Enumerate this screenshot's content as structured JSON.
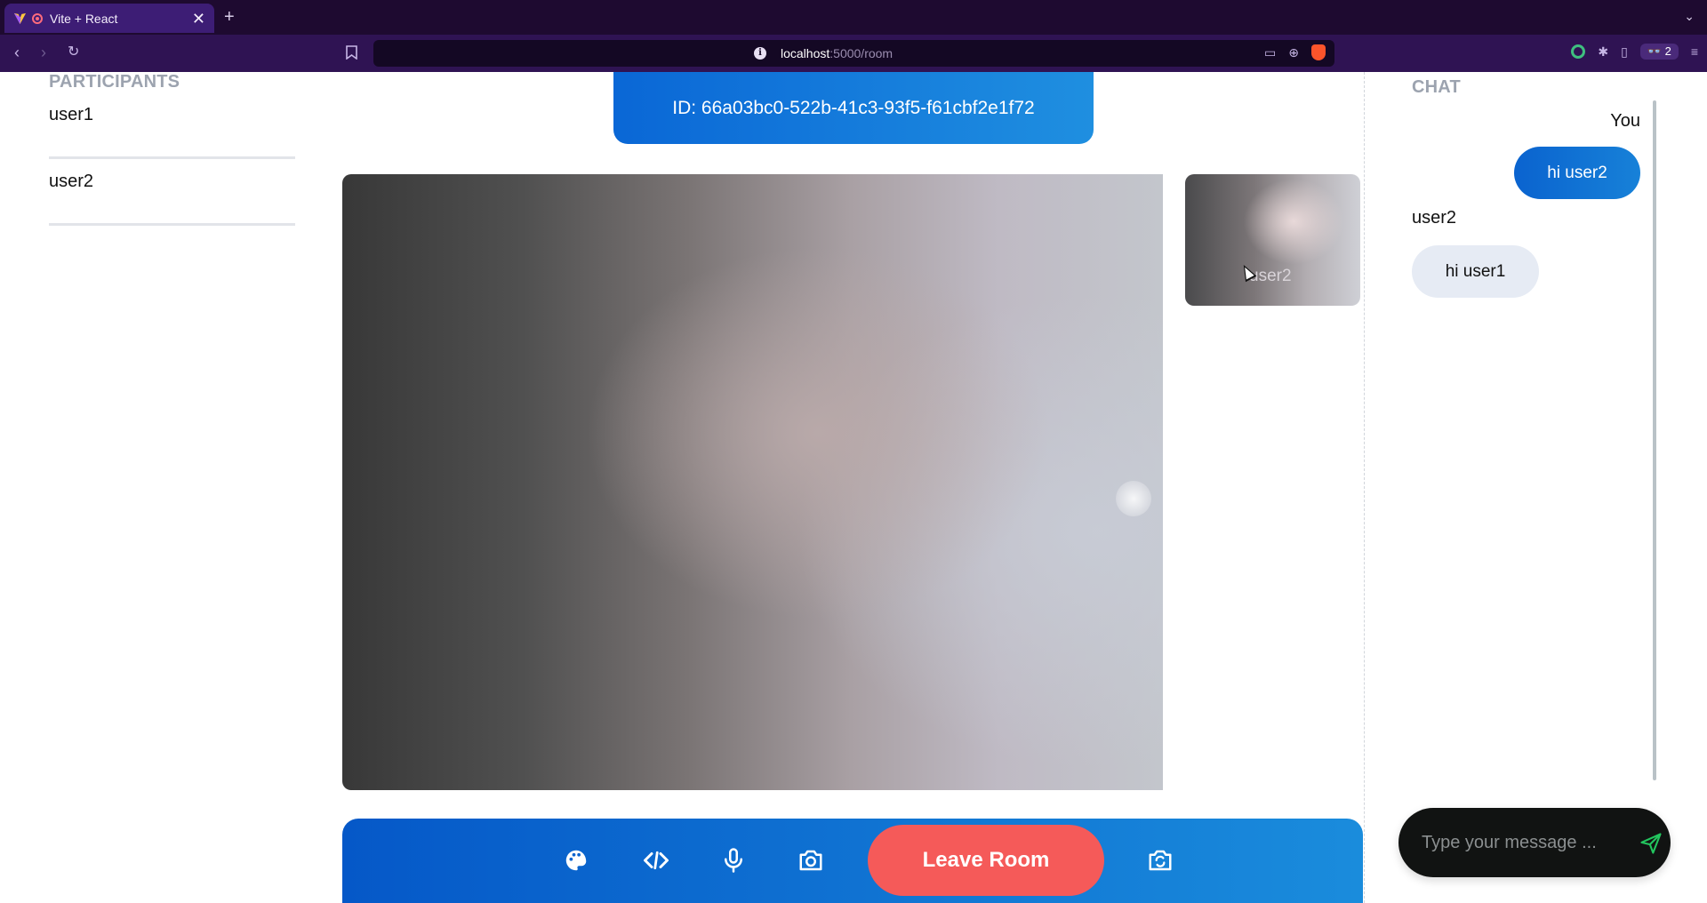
{
  "browser": {
    "tab_title": "Vite + React",
    "tab_close": "✕",
    "new_tab": "+",
    "url_host": "localhost",
    "url_path": ":5000/room",
    "extension_count": "2"
  },
  "participants": {
    "heading": "PARTICIPANTS",
    "items": [
      {
        "name": "user1"
      },
      {
        "name": "user2"
      }
    ]
  },
  "room": {
    "id_label": "ID: 66a03bc0-522b-41c3-93f5-f61cbf2e1f72"
  },
  "video": {
    "thumbnail_name": "user2"
  },
  "controls": {
    "leave_label": "Leave Room",
    "icons": [
      "palette-icon",
      "code-icon",
      "microphone-icon",
      "camera-icon",
      "switch-camera-icon"
    ]
  },
  "chat": {
    "heading": "CHAT",
    "messages": [
      {
        "sender": "You",
        "text": "hi user2"
      },
      {
        "sender": "user2",
        "text": "hi user1"
      }
    ],
    "input_placeholder": "Type your message ..."
  },
  "colors": {
    "accent_blue": "#0a67d6",
    "leave_red": "#f55a59",
    "browser_bg": "#2f1353"
  }
}
